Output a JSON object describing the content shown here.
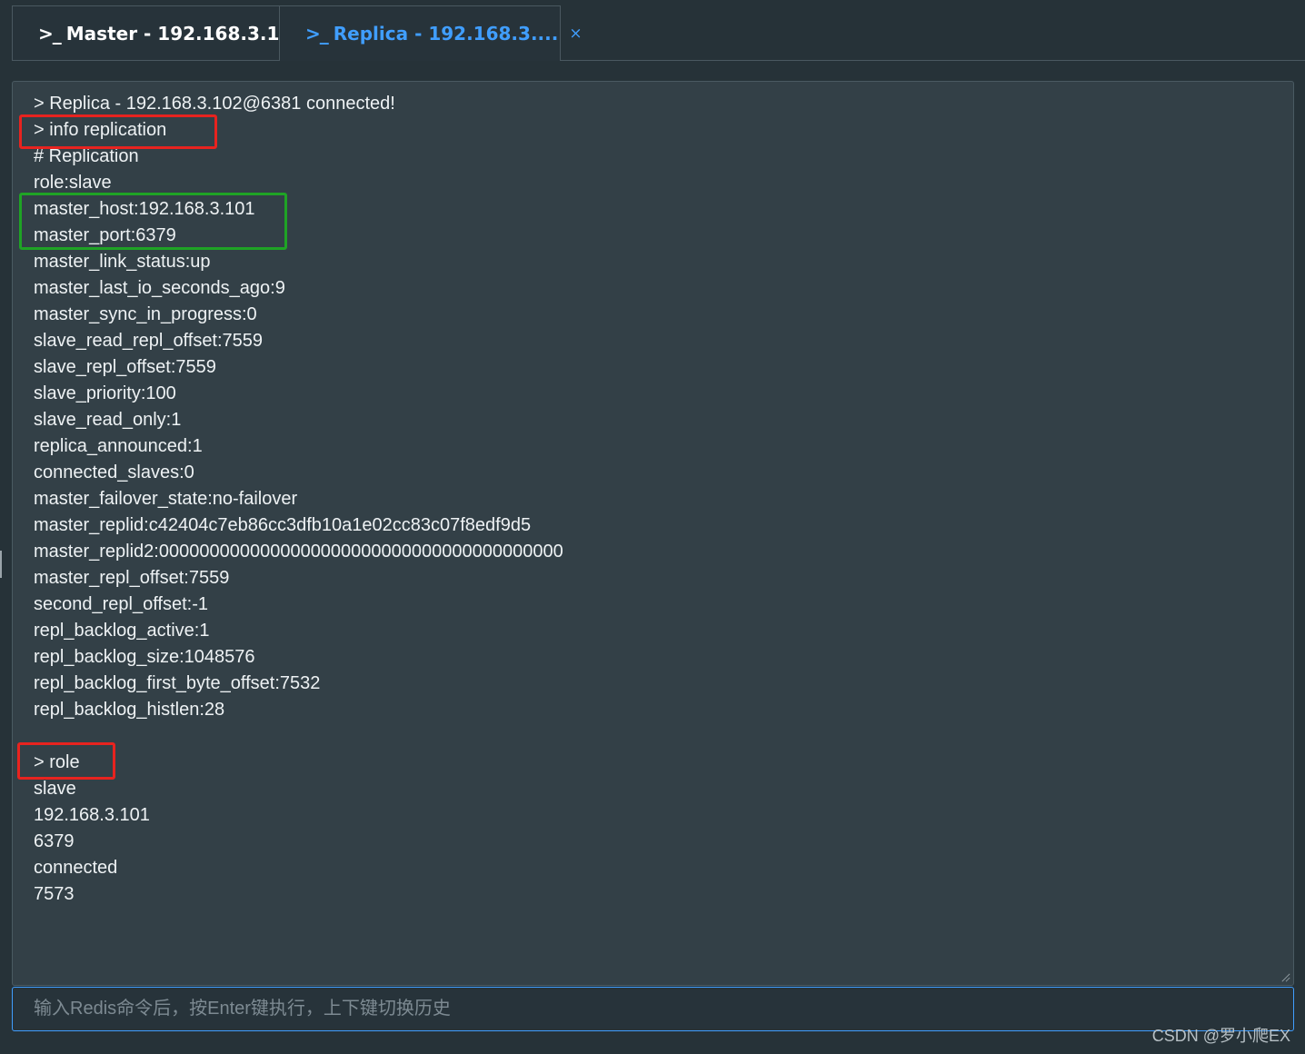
{
  "tabs": [
    {
      "icon": "terminal-icon",
      "glyph": ">_",
      "label": "Master - 192.168.3.1..."
    },
    {
      "icon": "terminal-icon",
      "glyph": ">_",
      "label": "Replica - 192.168.3....",
      "close_glyph": "×",
      "active": true
    }
  ],
  "console": {
    "lines": [
      "> Replica - 192.168.3.102@6381 connected!",
      "> info replication",
      "# Replication",
      "role:slave",
      "master_host:192.168.3.101",
      "master_port:6379",
      "master_link_status:up",
      "master_last_io_seconds_ago:9",
      "master_sync_in_progress:0",
      "slave_read_repl_offset:7559",
      "slave_repl_offset:7559",
      "slave_priority:100",
      "slave_read_only:1",
      "replica_announced:1",
      "connected_slaves:0",
      "master_failover_state:no-failover",
      "master_replid:c42404c7eb86cc3dfb10a1e02cc83c07f8edf9d5",
      "master_replid2:0000000000000000000000000000000000000000",
      "master_repl_offset:7559",
      "second_repl_offset:-1",
      "repl_backlog_active:1",
      "repl_backlog_size:1048576",
      "repl_backlog_first_byte_offset:7532",
      "repl_backlog_histlen:28",
      "",
      "> role",
      "slave",
      "192.168.3.101",
      "6379",
      "connected",
      "7573"
    ]
  },
  "input": {
    "placeholder": "输入Redis命令后，按Enter键执行，上下键切换历史",
    "value": ""
  },
  "watermark": "CSDN @罗小爬EX",
  "colors": {
    "background": "#263238",
    "console_bg": "#334047",
    "accent": "#409eff",
    "highlight_red": "#e8231f",
    "highlight_green": "#1fa325"
  }
}
